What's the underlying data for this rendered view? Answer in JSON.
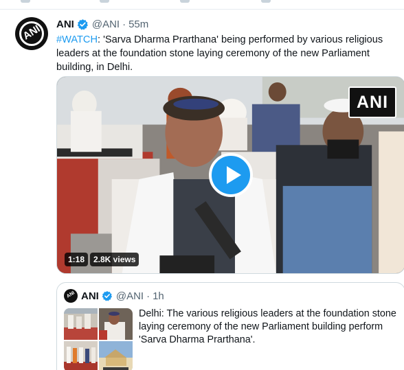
{
  "tweet": {
    "author_name": "ANI",
    "author_handle": "@ANI",
    "separator": "·",
    "time": "55m",
    "avatar_logo": "ANI",
    "hashtag": "#WATCH",
    "body": ": 'Sarva Dharma Prarthana' being performed by various religious leaders at the foundation stone laying ceremony of the new Parliament building, in Delhi.",
    "media": {
      "watermark": "ANI",
      "duration": "1:18",
      "views": "2.8K views",
      "play_icon": "play-icon"
    }
  },
  "quoted_tweet": {
    "author_name": "ANI",
    "author_handle": "@ANI",
    "separator": "·",
    "time": "1h",
    "avatar_logo": "ANI",
    "body": "Delhi: The various religious leaders at the foundation stone laying ceremony of the new Parliament building perform 'Sarva Dharma Prarthana'."
  },
  "colors": {
    "accent": "#1d9bf0",
    "text": "#0f1419",
    "muted": "#536471",
    "border": "#cfd9de"
  },
  "icons": {
    "verified": "verified-badge-icon",
    "play": "play-icon"
  }
}
